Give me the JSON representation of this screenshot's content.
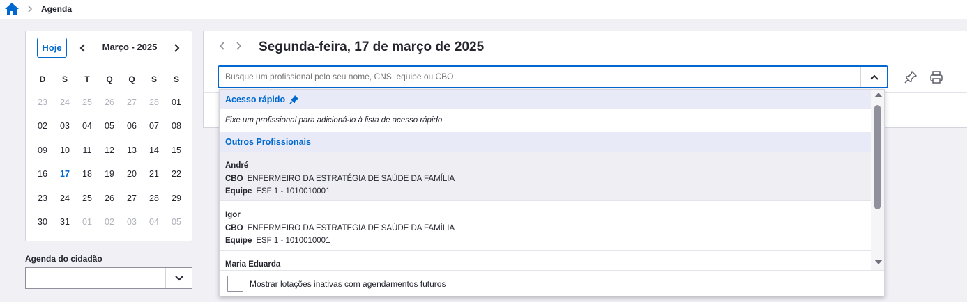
{
  "breadcrumb": {
    "current": "Agenda"
  },
  "calendar": {
    "today_button": "Hoje",
    "month_label": "Março - 2025",
    "weekdays": [
      "D",
      "S",
      "T",
      "Q",
      "Q",
      "S",
      "S"
    ],
    "weeks": [
      [
        "23",
        "24",
        "25",
        "26",
        "27",
        "28",
        "01"
      ],
      [
        "02",
        "03",
        "04",
        "05",
        "06",
        "07",
        "08"
      ],
      [
        "09",
        "10",
        "11",
        "12",
        "13",
        "14",
        "15"
      ],
      [
        "16",
        "17",
        "18",
        "19",
        "20",
        "21",
        "22"
      ],
      [
        "23",
        "24",
        "25",
        "26",
        "27",
        "28",
        "29"
      ],
      [
        "30",
        "31",
        "01",
        "02",
        "03",
        "04",
        "05"
      ]
    ],
    "selected_day": "17"
  },
  "citizen_agenda": {
    "label": "Agenda do cidadão",
    "value": ""
  },
  "main": {
    "date_title": "Segunda-feira, 17 de março de 2025",
    "search": {
      "placeholder": "Busque um profissional pelo seu nome, CNS, equipe ou CBO",
      "value": ""
    }
  },
  "dropdown": {
    "quick_access": {
      "title": "Acesso rápido",
      "hint": "Fixe um profissional para adicioná-lo à lista de acesso rápido."
    },
    "others_title": "Outros Profissionais",
    "cbo_label": "CBO",
    "team_label": "Equipe",
    "professionals": [
      {
        "name": "André",
        "cbo": "ENFERMEIRO DA ESTRATÉGIA DE SAÚDE DA FAMÍLIA",
        "team": "ESF 1 - 1010010001"
      },
      {
        "name": "Igor",
        "cbo": "ENFERMEIRO DA ESTRATEGIA DE SAÚDE DA FAMÍLIA",
        "team": "ESF 1 - 1010010001"
      },
      {
        "name": "Maria Eduarda",
        "cbo": "",
        "team": ""
      }
    ],
    "inactive_checkbox_label": "Mostrar lotações inativas com agendamentos futuros",
    "inactive_checkbox_checked": false
  },
  "colors": {
    "primary": "#0069d0",
    "muted_day": "#b0b2bd",
    "section_bg": "#e8ebf7"
  }
}
